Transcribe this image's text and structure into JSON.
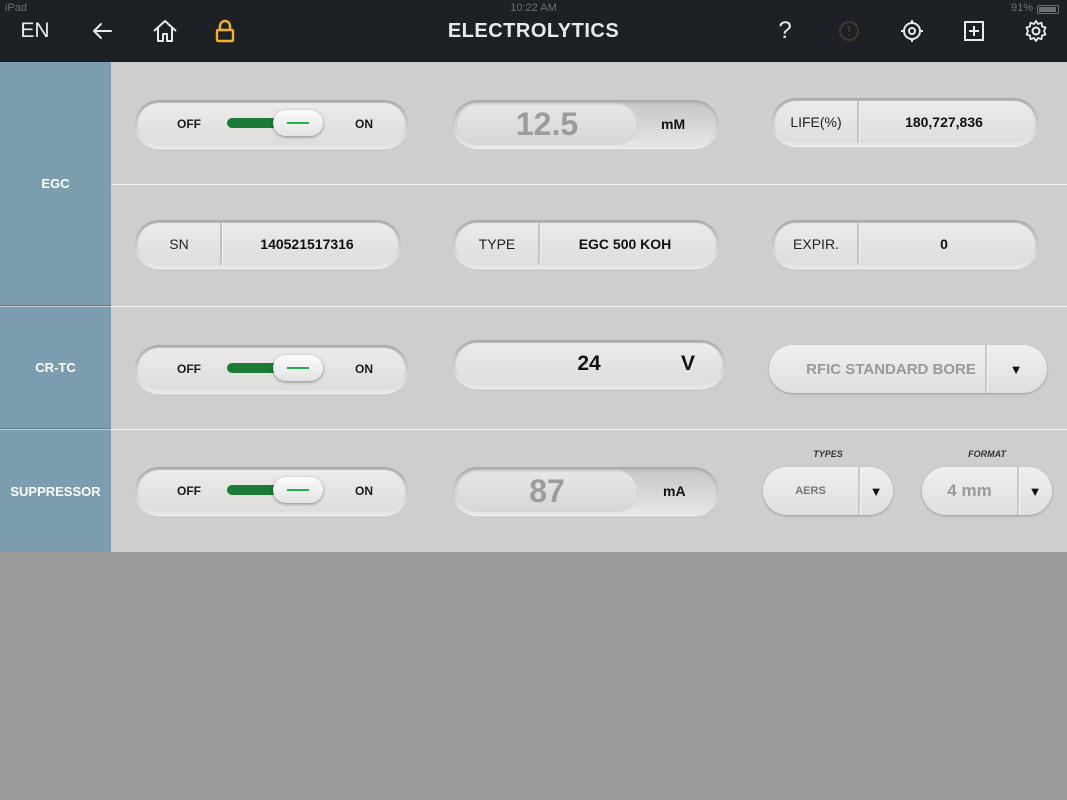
{
  "status_bar": {
    "device": "iPad",
    "time": "10:22 AM",
    "battery": "91%"
  },
  "nav": {
    "language": "EN",
    "title": "ELECTROLYTICS",
    "help": "?"
  },
  "icons": {
    "back": "arrow-left-icon",
    "home": "home-icon",
    "lock": "lock-icon",
    "alert": "alert-icon",
    "target": "crosshair-icon",
    "add": "add-box-icon",
    "settings": "gear-icon"
  },
  "colors": {
    "lock": "#f0b323",
    "toggle_on": "#1b7a35",
    "sidebar": "#7b9daf",
    "topbar": "#1d2126"
  },
  "sections": {
    "egc": {
      "label": "EGC",
      "toggle": {
        "off_label": "OFF",
        "on_label": "ON",
        "state": "on"
      },
      "concentration": {
        "value": "12.5",
        "unit": "mM"
      },
      "life": {
        "label": "LIFE(%)",
        "value": "180,727,836"
      },
      "sn": {
        "label": "SN",
        "value": "140521517316"
      },
      "type": {
        "label": "TYPE",
        "value": "EGC 500 KOH"
      },
      "expir": {
        "label": "EXPIR.",
        "value": "0"
      }
    },
    "crtc": {
      "label": "CR-TC",
      "toggle": {
        "off_label": "OFF",
        "on_label": "ON",
        "state": "on"
      },
      "voltage": {
        "value": "24",
        "unit": "V"
      },
      "bore": {
        "selected": "RFIC STANDARD BORE",
        "arrow": "▼"
      }
    },
    "suppressor": {
      "label": "SUPPRESSOR",
      "toggle": {
        "off_label": "OFF",
        "on_label": "ON",
        "state": "on"
      },
      "current": {
        "value": "87",
        "unit": "mA"
      },
      "types": {
        "caption": "TYPES",
        "selected": "AERS",
        "arrow": "▼"
      },
      "format": {
        "caption": "FORMAT",
        "selected": "4 mm",
        "arrow": "▼"
      }
    }
  }
}
